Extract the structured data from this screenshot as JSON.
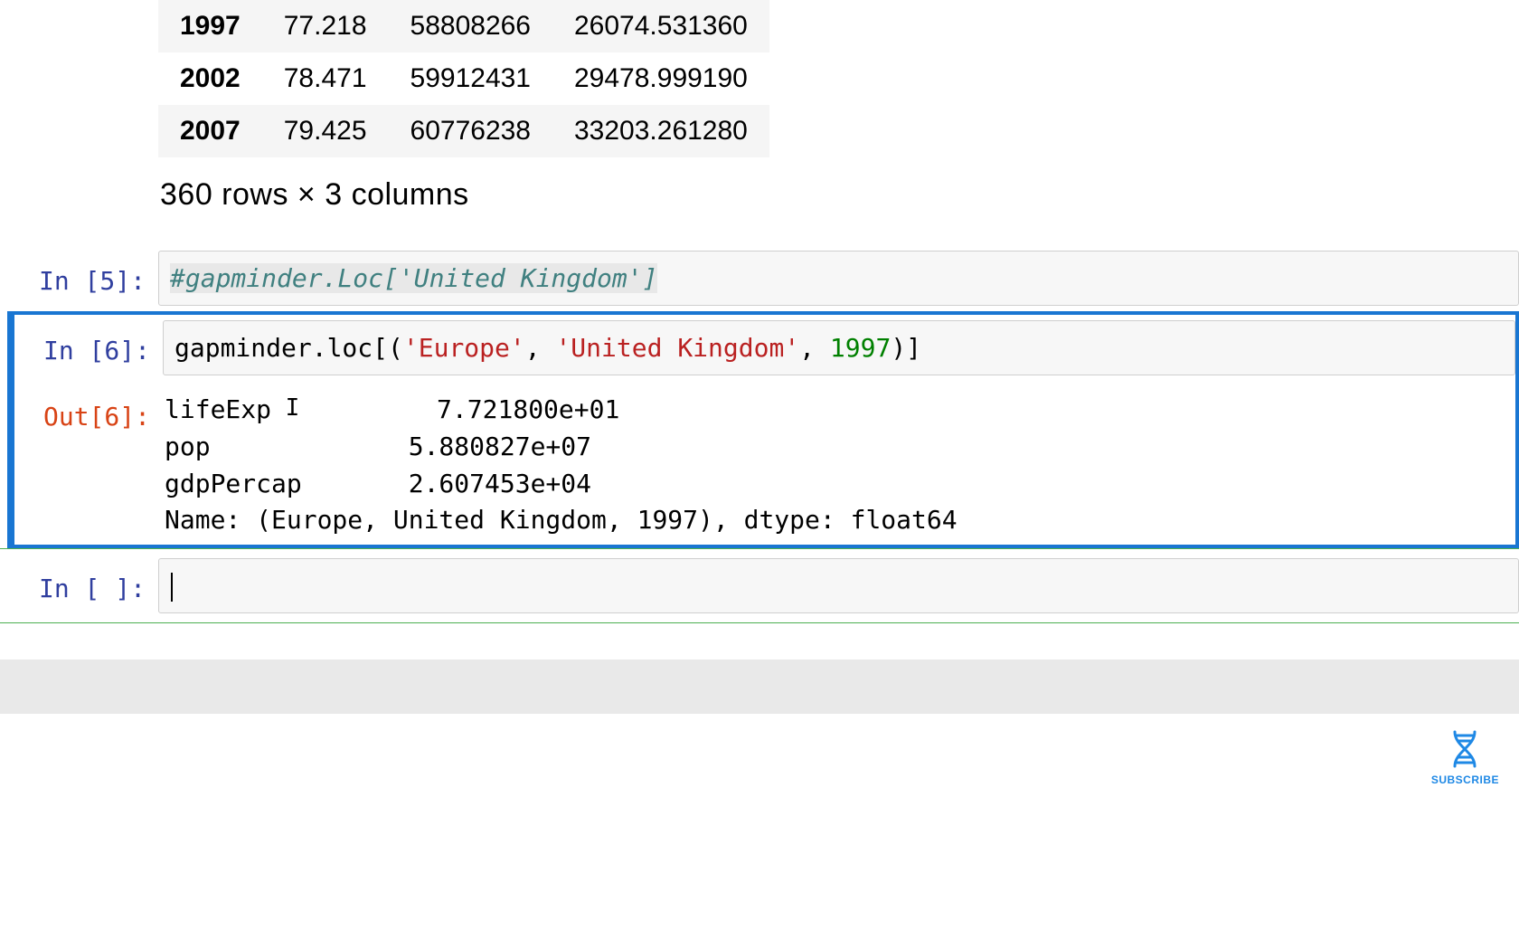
{
  "table": {
    "rows": [
      {
        "year": "1997",
        "lifeExp": "77.218",
        "pop": "58808266",
        "gdp": "26074.531360"
      },
      {
        "year": "2002",
        "lifeExp": "78.471",
        "pop": "59912431",
        "gdp": "29478.999190"
      },
      {
        "year": "2007",
        "lifeExp": "79.425",
        "pop": "60776238",
        "gdp": "33203.261280"
      }
    ],
    "summary": "360 rows × 3 columns"
  },
  "cells": {
    "in5": {
      "prompt": "In [5]:",
      "comment": "#gapminder.Loc['United Kingdom']"
    },
    "in6": {
      "prompt": "In [6]:",
      "code_prefix": "gapminder.loc[(",
      "str1": "'Europe'",
      "sep1": ", ",
      "str2": "'United Kingdom'",
      "sep2": ", ",
      "num": "1997",
      "code_suffix": ")]"
    },
    "out6": {
      "prompt": "Out[6]:",
      "line1": "lifeExp         7.721800e+01",
      "line2": "pop             5.880827e+07",
      "line3": "gdpPercap       2.607453e+04",
      "line4": "Name: (Europe, United Kingdom, 1997), dtype: float64"
    },
    "empty": {
      "prompt": "In [ ]:"
    }
  },
  "subscribe": {
    "label": "SUBSCRIBE"
  }
}
